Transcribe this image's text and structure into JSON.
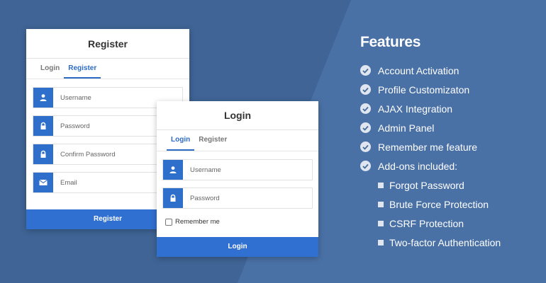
{
  "register_card": {
    "title": "Register",
    "tabs": [
      {
        "label": "Login"
      },
      {
        "label": "Register"
      }
    ],
    "fields": [
      {
        "placeholder": "Username",
        "icon": "user-icon"
      },
      {
        "placeholder": "Password",
        "icon": "lock-icon"
      },
      {
        "placeholder": "Confirm Password",
        "icon": "lock-icon"
      },
      {
        "placeholder": "Email",
        "icon": "envelope-icon"
      }
    ],
    "submit_label": "Register"
  },
  "login_card": {
    "title": "Login",
    "tabs": [
      {
        "label": "Login"
      },
      {
        "label": "Register"
      }
    ],
    "fields": [
      {
        "placeholder": "Username",
        "icon": "user-icon"
      },
      {
        "placeholder": "Password",
        "icon": "lock-icon"
      }
    ],
    "remember_label": "Remember me",
    "submit_label": "Login"
  },
  "features": {
    "title": "Features",
    "items": [
      "Account Activation",
      "Profile Customizaton",
      "AJAX Integration",
      "Admin Panel",
      "Remember me feature",
      "Add-ons included:"
    ],
    "addons": [
      "Forgot Password",
      "Brute Force Protection",
      "CSRF Protection",
      "Two-factor Authentication"
    ]
  },
  "colors": {
    "accent": "#2e6fcb",
    "background": "#44699b"
  }
}
